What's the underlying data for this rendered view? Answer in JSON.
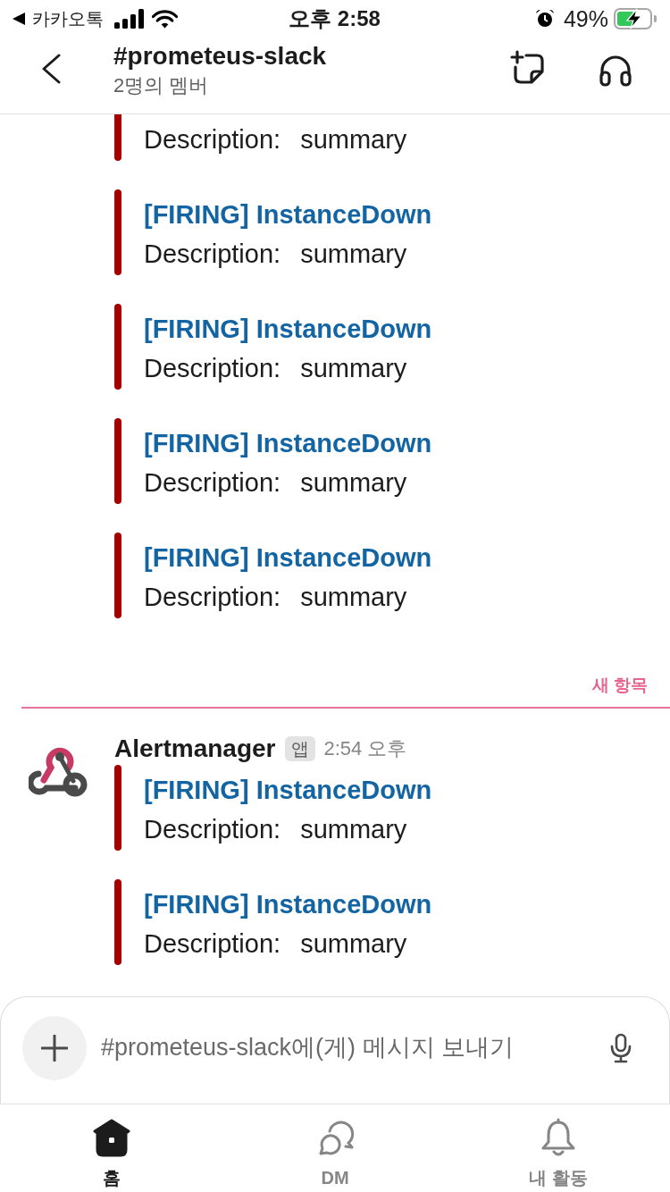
{
  "status_bar": {
    "back_app": "카카오톡",
    "time": "오후 2:58",
    "battery": "49%"
  },
  "header": {
    "title": "#prometeus-slack",
    "subtitle": "2명의 멤버"
  },
  "earlier_attachments": [
    {
      "description_label": "Description:",
      "description_value": "summary"
    },
    {
      "title": "[FIRING] InstanceDown",
      "description_label": "Description:",
      "description_value": "summary"
    },
    {
      "title": "[FIRING] InstanceDown",
      "description_label": "Description:",
      "description_value": "summary"
    },
    {
      "title": "[FIRING] InstanceDown",
      "description_label": "Description:",
      "description_value": "summary"
    },
    {
      "title": "[FIRING] InstanceDown",
      "description_label": "Description:",
      "description_value": "summary"
    }
  ],
  "new_divider": {
    "label": "새 항목"
  },
  "message": {
    "sender": "Alertmanager",
    "badge": "앱",
    "time": "2:54 오후",
    "attachments": [
      {
        "title": "[FIRING] InstanceDown",
        "description_label": "Description:",
        "description_value": "summary"
      },
      {
        "title": "[FIRING] InstanceDown",
        "description_label": "Description:",
        "description_value": "summary"
      }
    ]
  },
  "composer": {
    "placeholder": "#prometeus-slack에(게) 메시지 보내기"
  },
  "tabs": [
    {
      "kind": "home",
      "label": "홈",
      "selected": true
    },
    {
      "kind": "dm",
      "label": "DM",
      "selected": false
    },
    {
      "kind": "activity",
      "label": "내 활동",
      "selected": false
    }
  ]
}
